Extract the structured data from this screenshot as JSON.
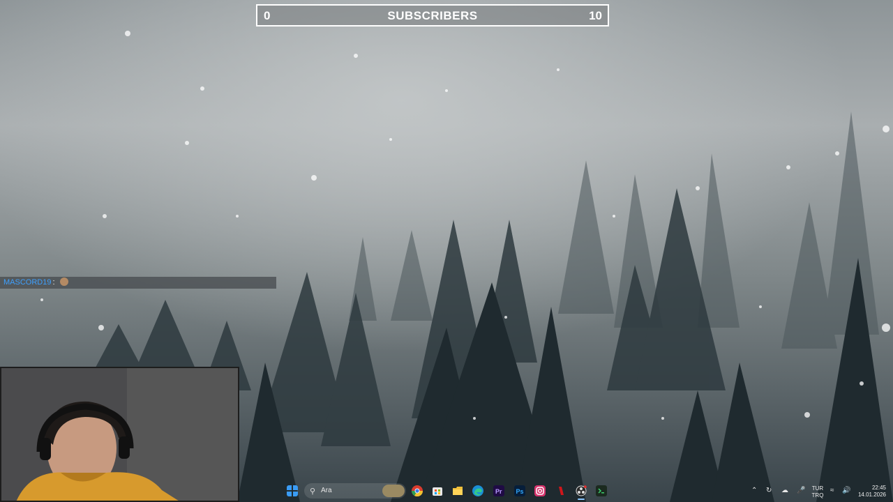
{
  "subscriber_goal": {
    "current": "0",
    "title": "SUBSCRIBERS",
    "target": "10",
    "progress_fraction": 0
  },
  "chat": {
    "username": "MASCORD19",
    "separator": ":",
    "emote_icon": "face-emote-icon",
    "username_color": "#3ea0ff"
  },
  "taskbar": {
    "search_placeholder": "Ara",
    "pinned_apps": [
      "start-icon",
      "search-icon",
      "chrome-icon",
      "store-icon",
      "file-explorer-icon",
      "edge-icon",
      "premiere-pro-icon",
      "photoshop-icon",
      "instagram-icon",
      "app-red-icon",
      "obs-icon",
      "terminal-icon"
    ],
    "language_top": "TUR",
    "language_bottom": "TRQ",
    "time": "22:45",
    "date": "14.01.2026"
  },
  "colors": {
    "accent_windows": "#3a9cf5",
    "bar_border": "#ffffff"
  }
}
